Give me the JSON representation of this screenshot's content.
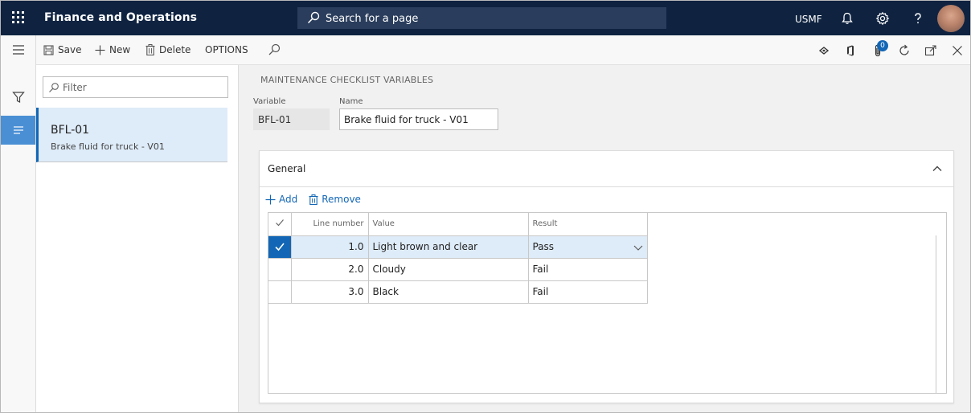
{
  "app": {
    "title": "Finance and Operations",
    "search_placeholder": "Search for a page",
    "company": "USMF",
    "notification_count": "0"
  },
  "actionpane": {
    "save_label": "Save",
    "new_label": "New",
    "delete_label": "Delete",
    "options_label": "OPTIONS"
  },
  "listpane": {
    "filter_placeholder": "Filter",
    "items": [
      {
        "title": "BFL-01",
        "subtitle": "Brake fluid for truck - V01"
      }
    ]
  },
  "form": {
    "caption": "MAINTENANCE CHECKLIST VARIABLES",
    "variable_label": "Variable",
    "variable_value": "BFL-01",
    "name_label": "Name",
    "name_value": "Brake fluid for truck - V01"
  },
  "general": {
    "title": "General",
    "add_label": "Add",
    "remove_label": "Remove",
    "columns": [
      "Line number",
      "Value",
      "Result"
    ],
    "rows": [
      {
        "line": "1.0",
        "value": "Light brown and clear",
        "result": "Pass",
        "selected": true
      },
      {
        "line": "2.0",
        "value": "Cloudy",
        "result": "Fail",
        "selected": false
      },
      {
        "line": "3.0",
        "value": "Black",
        "result": "Fail",
        "selected": false
      }
    ]
  },
  "colors": {
    "topbar": "#0f2341",
    "accent": "#1266b5",
    "selection": "#deebf8"
  }
}
